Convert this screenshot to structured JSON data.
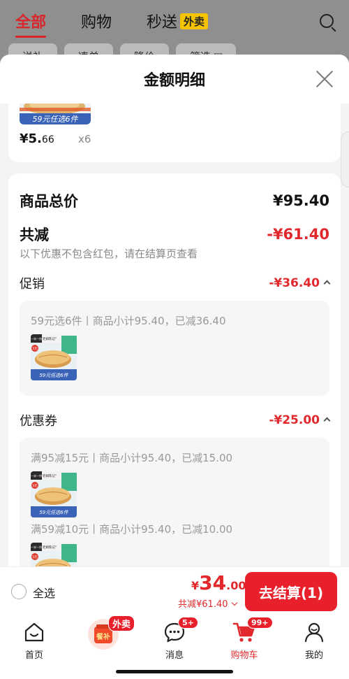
{
  "background": {
    "tabs": [
      {
        "label": "全部"
      },
      {
        "label": "购物"
      },
      {
        "label": "秒送"
      }
    ],
    "waimai_badge": "外卖",
    "chips": [
      {
        "label": "送礼"
      },
      {
        "label": "凑单"
      },
      {
        "label": "降价"
      },
      {
        "label": "筛选 ▽"
      }
    ]
  },
  "sheet": {
    "title": "金额明细"
  },
  "item_card": {
    "thumb_banner": "59元任选6件",
    "price_symbol": "¥",
    "price_int": "5.",
    "price_dec": "66",
    "qty": "x6"
  },
  "summary": {
    "total_label": "商品总价",
    "total_value": "¥95.40",
    "reduce_label": "共减",
    "reduce_value": "-¥61.40",
    "note": "以下优惠不包含红包，请在结算页查看",
    "promo": {
      "label": "促销",
      "value": "-¥36.40",
      "lines": [
        {
          "text": "59元选6件丨商品小计95.40，已减36.40"
        }
      ]
    },
    "coupon": {
      "label": "优惠券",
      "value": "-¥25.00",
      "lines": [
        {
          "text": "满95减15元丨商品小计95.40，已减15.00"
        },
        {
          "text": "满59减10元丨商品小计95.40，已减10.00"
        }
      ]
    }
  },
  "product_image": {
    "brand": "一米一饼",
    "tag": "\"老姆陈记\"",
    "badge": "5元",
    "banner": "59元任选6件"
  },
  "bottom_bar": {
    "select_all": "全选",
    "price_symbol": "¥",
    "price_int": "34",
    "price_dec": ".00",
    "reduce_text": "共减¥61.40",
    "checkout": "去结算(1)"
  },
  "tabbar": {
    "items": [
      {
        "label": "首页"
      },
      {
        "label": "",
        "badge": "外卖",
        "icon_text": "餐补"
      },
      {
        "label": "消息",
        "badge": "5+"
      },
      {
        "label": "购物车",
        "badge": "99+"
      },
      {
        "label": "我的"
      }
    ]
  },
  "colors": {
    "accent": "#e0282d",
    "button": "#e8202c",
    "waimai": "#f5c400"
  }
}
